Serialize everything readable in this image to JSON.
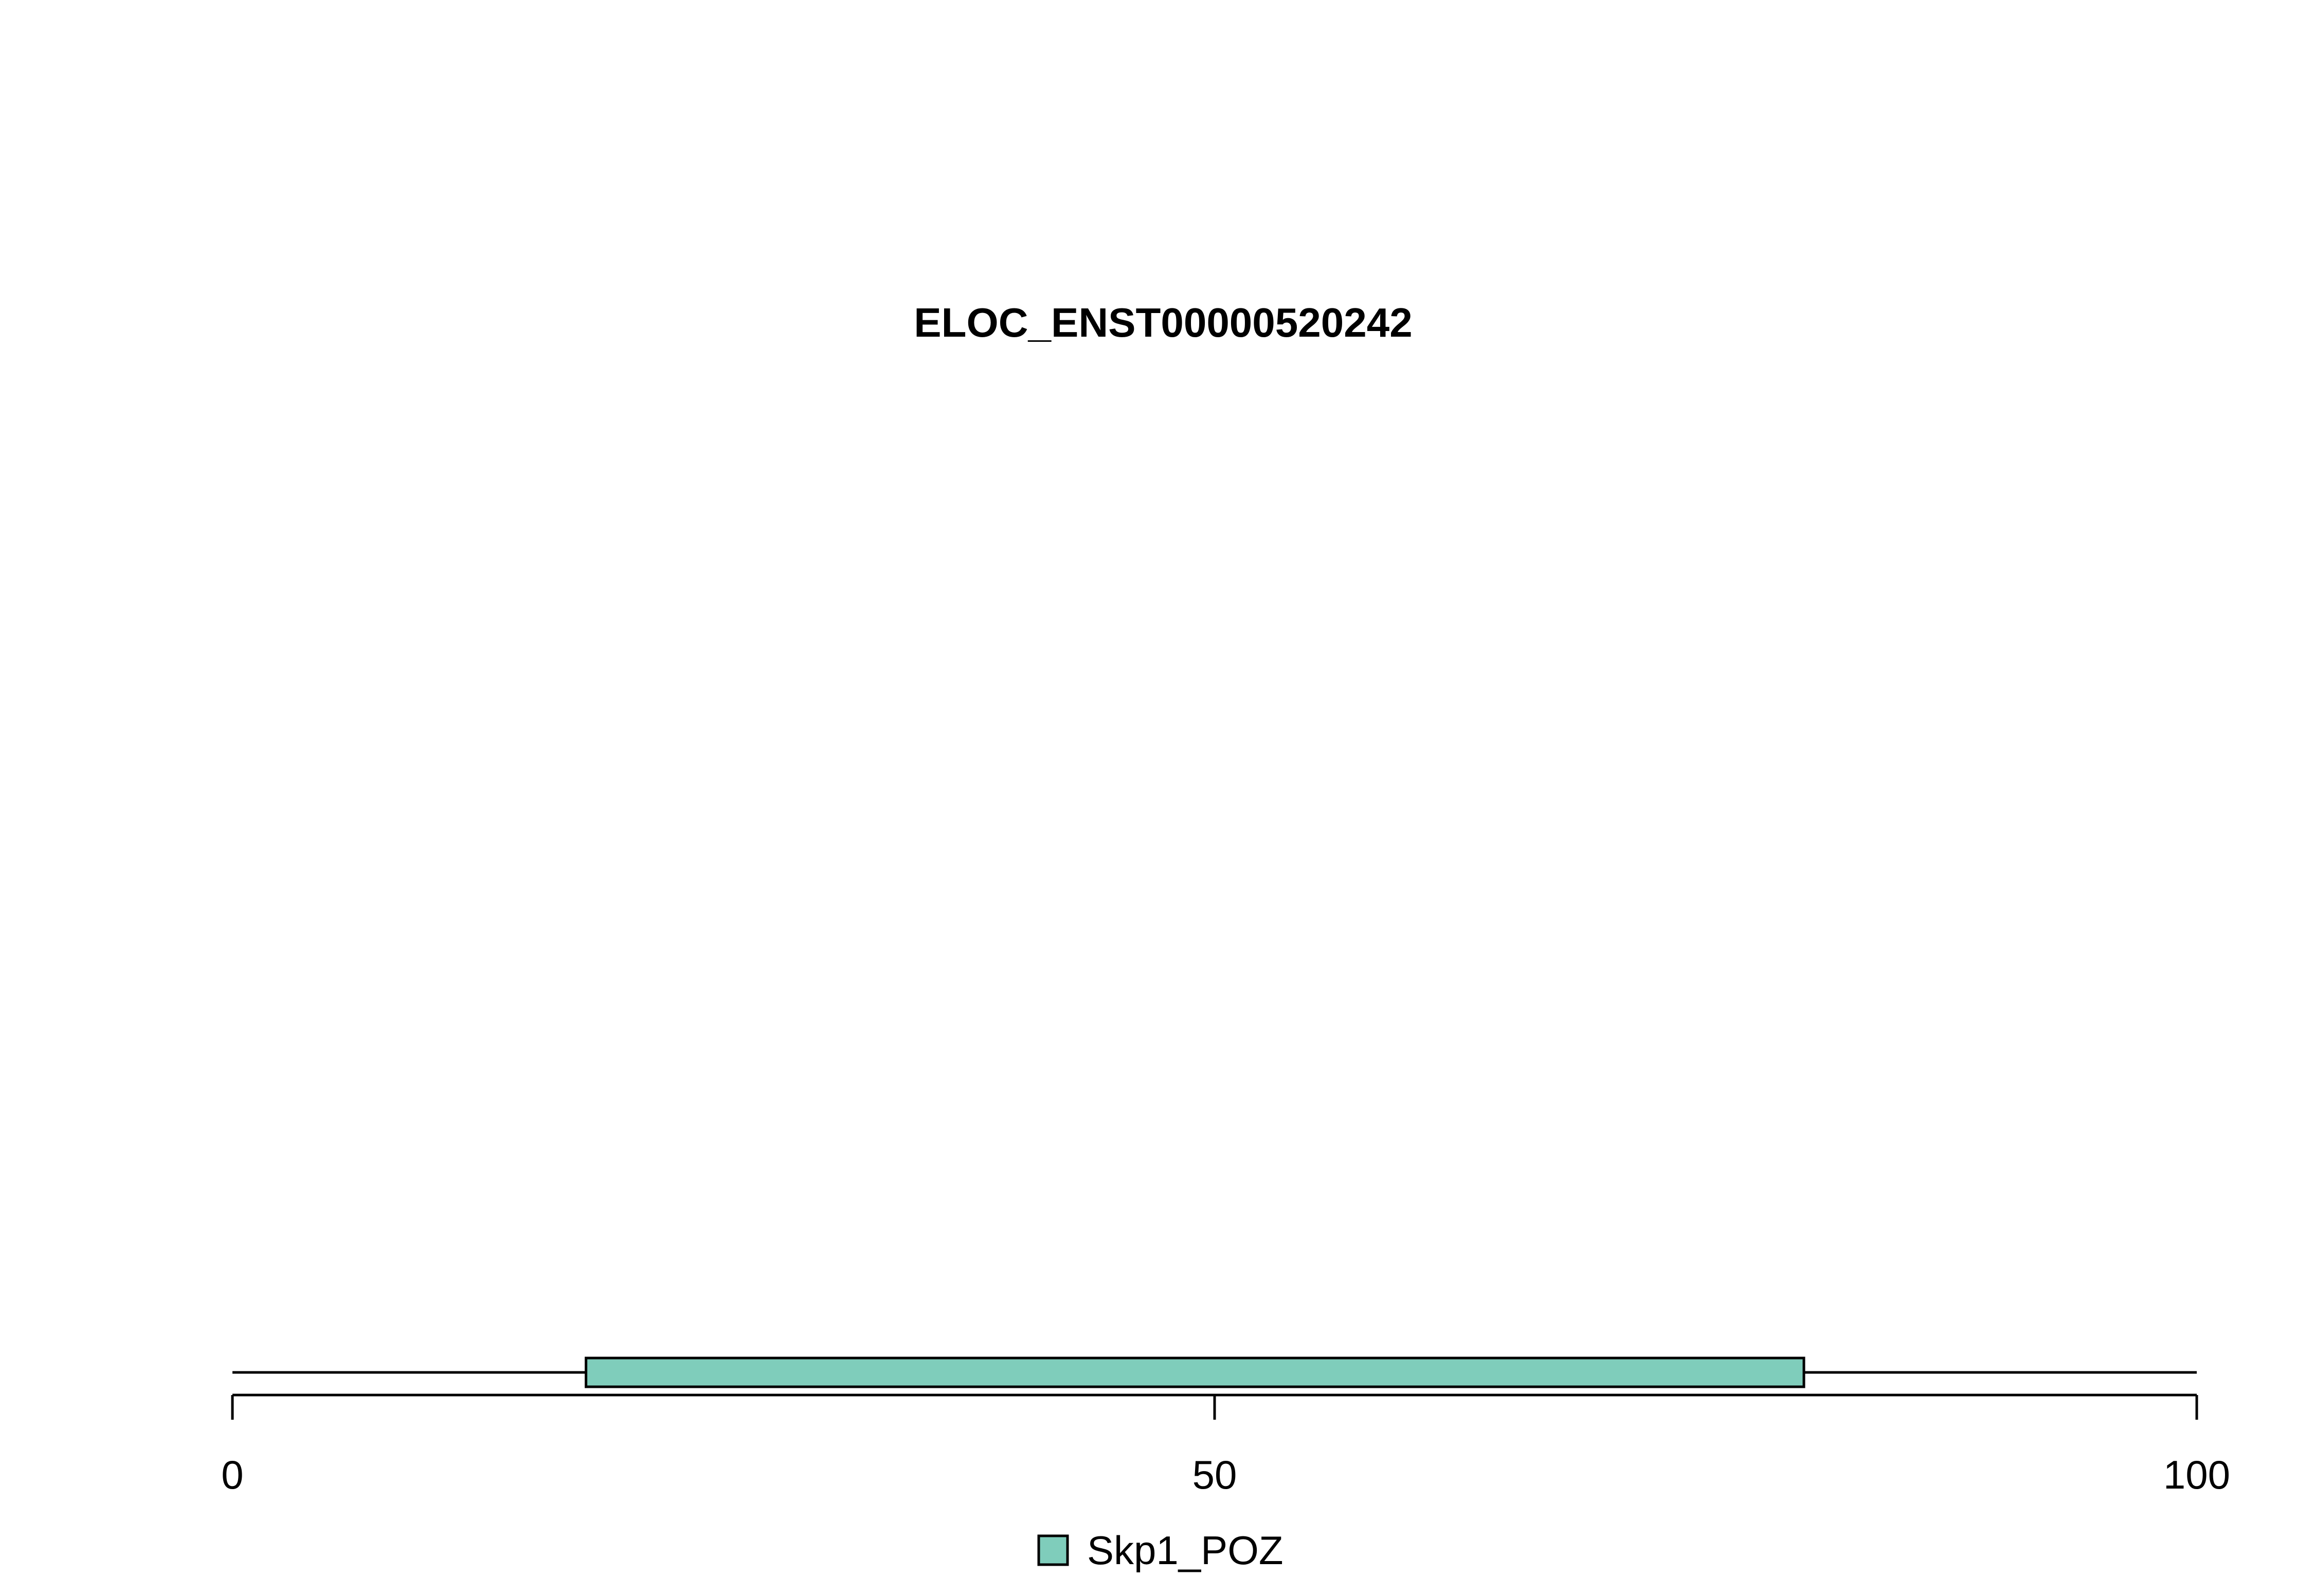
{
  "chart_data": {
    "type": "bar",
    "title": "ELOC_ENST00000520242",
    "xlabel": "",
    "ylabel": "",
    "xlim": [
      0,
      100
    ],
    "x_ticks": [
      0,
      50,
      100
    ],
    "x_tick_labels": [
      "0",
      "50",
      "100"
    ],
    "protein_length": 100,
    "domains": [
      {
        "name": "Skp1_POZ",
        "start": 18,
        "end": 80,
        "color": "#7fcdbb"
      }
    ],
    "legend": {
      "placement": "bottom-center",
      "entries": [
        {
          "label": "Skp1_POZ",
          "color": "#7fcdbb"
        }
      ]
    },
    "grid": false
  }
}
